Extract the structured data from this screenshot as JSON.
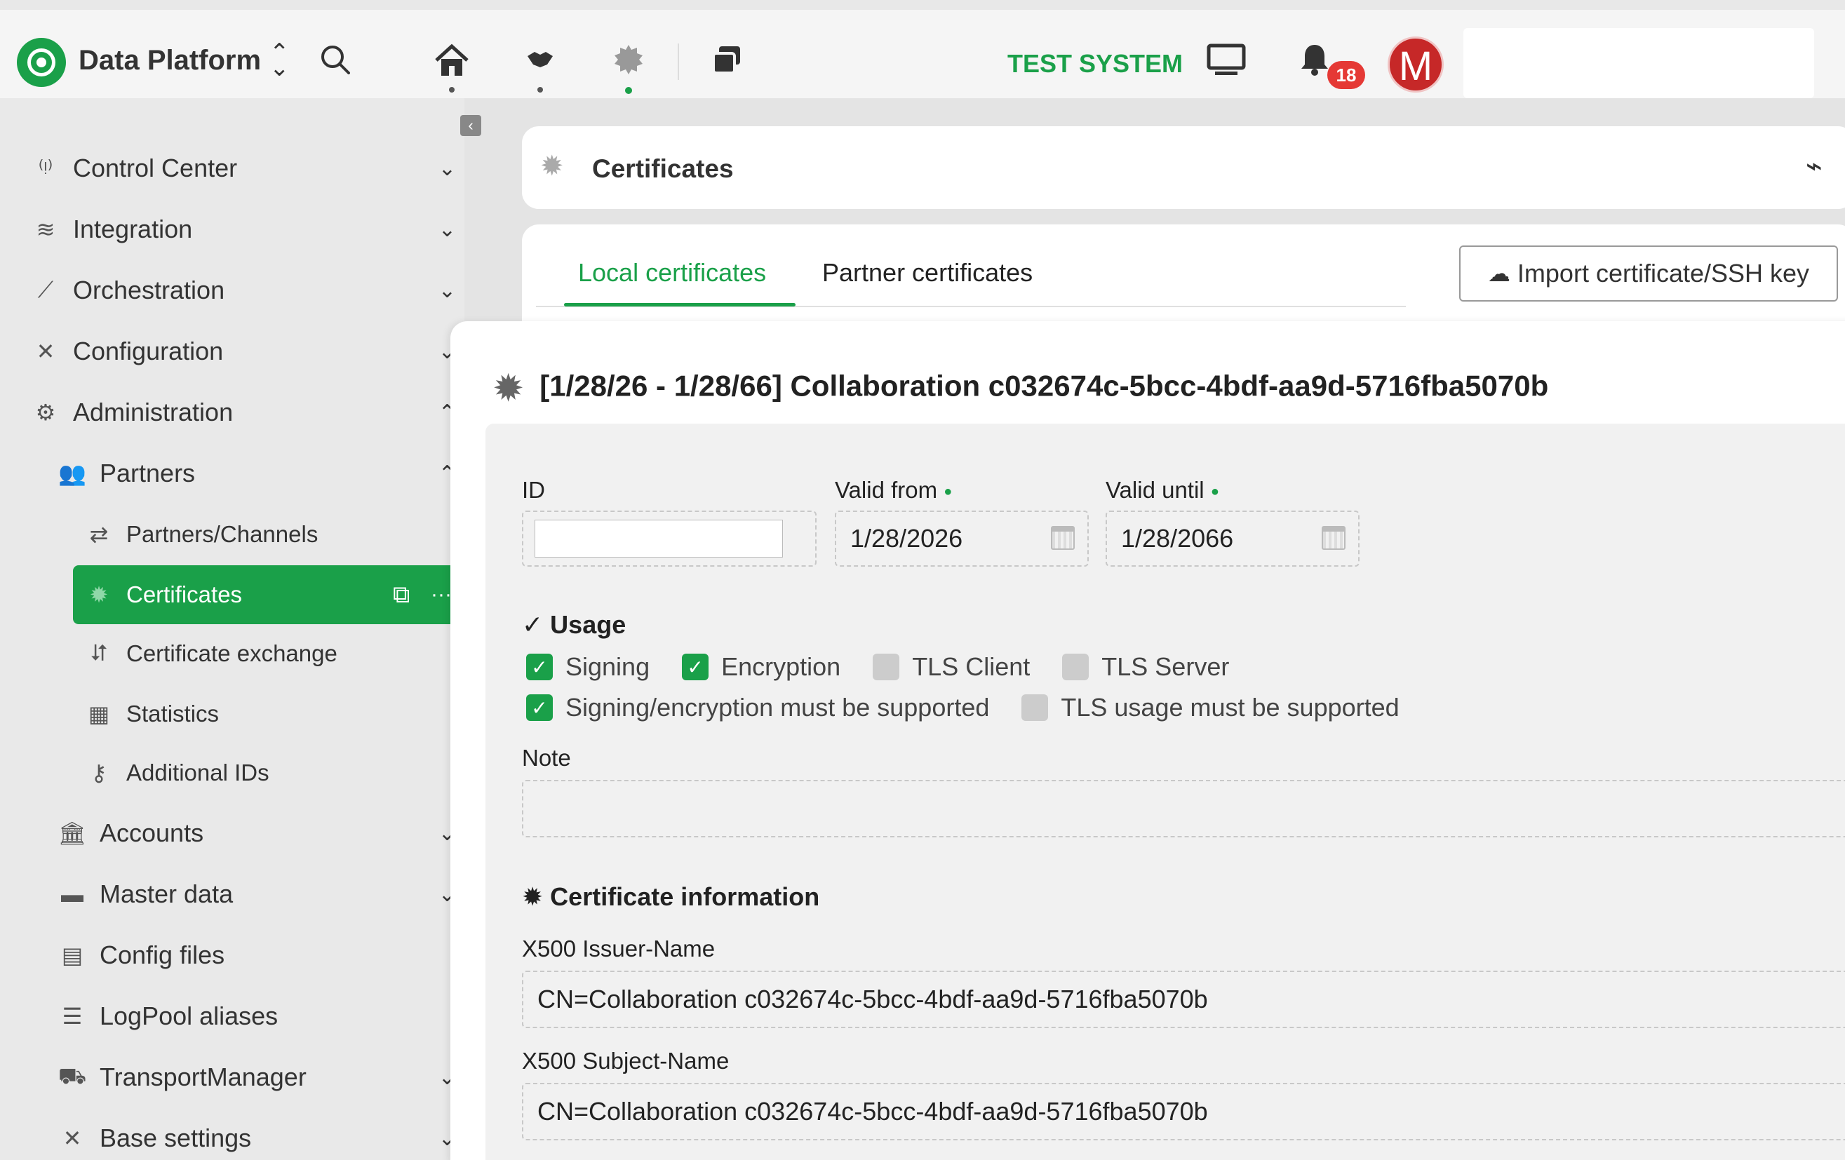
{
  "topbar": {
    "app_title": "Data Platform",
    "environment": "TEST SYSTEM",
    "notification_count": "18",
    "avatar_initial": "M"
  },
  "sidebar": {
    "items": [
      {
        "label": "Control Center",
        "icon": "antenna-icon"
      },
      {
        "label": "Integration",
        "icon": "layers-icon"
      },
      {
        "label": "Orchestration",
        "icon": "magic-wand-icon"
      },
      {
        "label": "Configuration",
        "icon": "tools-icon"
      },
      {
        "label": "Administration",
        "icon": "gears-icon"
      },
      {
        "label": "Partners",
        "icon": "users-icon"
      },
      {
        "label": "Partners/Channels",
        "icon": "exchange-arrows-icon"
      },
      {
        "label": "Certificates",
        "icon": "certificate-icon"
      },
      {
        "label": "Certificate exchange",
        "icon": "swap-icon"
      },
      {
        "label": "Statistics",
        "icon": "calendar-icon"
      },
      {
        "label": "Additional IDs",
        "icon": "key-icon"
      },
      {
        "label": "Accounts",
        "icon": "bank-icon"
      },
      {
        "label": "Master data",
        "icon": "folder-icon"
      },
      {
        "label": "Config files",
        "icon": "file-icon"
      },
      {
        "label": "LogPool aliases",
        "icon": "server-icon"
      },
      {
        "label": "TransportManager",
        "icon": "truck-icon"
      },
      {
        "label": "Base settings",
        "icon": "wrench-icon"
      }
    ]
  },
  "panel": {
    "title": "Certificates",
    "tabs": [
      "Local certificates",
      "Partner certificates"
    ],
    "import_button": "Import certificate/SSH key"
  },
  "detail": {
    "title": "[1/28/26 - 1/28/66] Collaboration c032674c-5bcc-4bdf-aa9d-5716fba5070b",
    "id_label": "ID",
    "id_value": "",
    "valid_from_label": "Valid from",
    "valid_from_value": "1/28/2026",
    "valid_until_label": "Valid until",
    "valid_until_value": "1/28/2066",
    "usage_title": "Usage",
    "usage": {
      "signing": "Signing",
      "encryption": "Encryption",
      "tls_client": "TLS Client",
      "tls_server": "TLS Server",
      "signing_required": "Signing/encryption must be supported",
      "tls_required": "TLS usage must be supported"
    },
    "note_label": "Note",
    "note_value": "",
    "cert_info_title": "Certificate information",
    "issuer_label": "X500 Issuer-Name",
    "issuer_value": "CN=Collaboration c032674c-5bcc-4bdf-aa9d-5716fba5070b",
    "subject_label": "X500 Subject-Name",
    "subject_value": "CN=Collaboration c032674c-5bcc-4bdf-aa9d-5716fba5070b"
  },
  "colors": {
    "accent": "#1aa049",
    "badge": "#e53935",
    "avatar": "#c62828"
  }
}
